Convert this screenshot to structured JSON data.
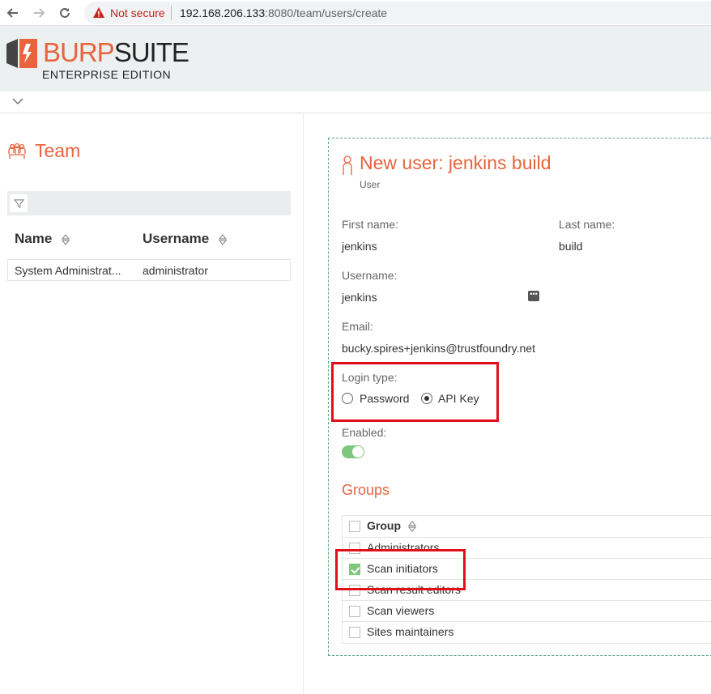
{
  "browser": {
    "security_label": "Not secure",
    "url_host": "192.168.206.133",
    "url_port": ":8080",
    "url_path": "/team/users/create"
  },
  "header": {
    "logo_burp": "BURP",
    "logo_suite": "SUITE",
    "logo_edition": "ENTERPRISE EDITION"
  },
  "team": {
    "title": "Team",
    "columns": [
      "Name",
      "Username"
    ],
    "rows": [
      {
        "name": "System Administrat...",
        "username": "administrator"
      }
    ]
  },
  "form": {
    "title": "New user: jenkins build",
    "subtitle": "User",
    "first_name_label": "First name:",
    "first_name_value": "jenkins",
    "last_name_label": "Last name:",
    "last_name_value": "build",
    "username_label": "Username:",
    "username_value": "jenkins",
    "email_label": "Email:",
    "email_value": "bucky.spires+jenkins@trustfoundry.net",
    "login_type_label": "Login type:",
    "login_options": [
      "Password",
      "API Key"
    ],
    "login_selected": "API Key",
    "enabled_label": "Enabled:",
    "enabled": true
  },
  "groups": {
    "title": "Groups",
    "column": "Group",
    "items": [
      {
        "label": "Administrators",
        "checked": false
      },
      {
        "label": "Scan initiators",
        "checked": true
      },
      {
        "label": "Scan result editors",
        "checked": false
      },
      {
        "label": "Scan viewers",
        "checked": false
      },
      {
        "label": "Sites maintainers",
        "checked": false
      }
    ]
  },
  "colors": {
    "accent": "#e8643c",
    "highlight": "#e0101a",
    "toggle_on": "#7dc87c"
  }
}
